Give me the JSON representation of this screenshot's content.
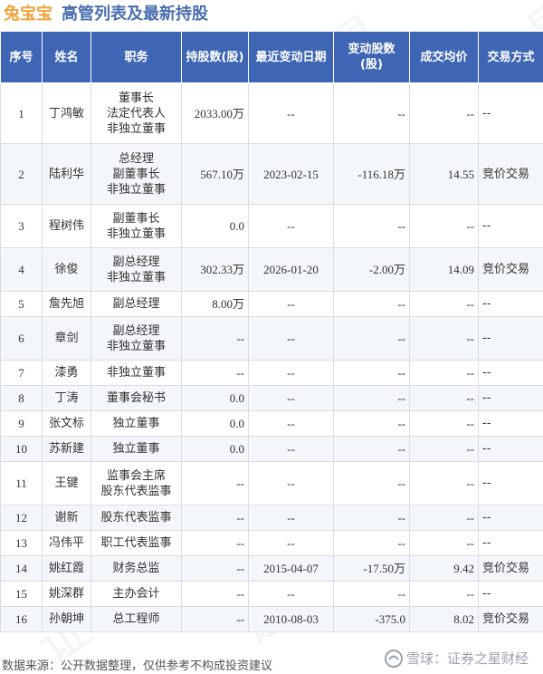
{
  "header": {
    "company": "兔宝宝",
    "title": "高管列表及最新持股"
  },
  "watermark_text": "证券之星",
  "table": {
    "columns": [
      "序号",
      "姓名",
      "职务",
      "持股数(股)",
      "最近变动日期",
      "变动股数(股)",
      "成交均价",
      "交易方式"
    ],
    "rows": [
      {
        "idx": "1",
        "name": "丁鸿敏",
        "positions": [
          "董事长",
          "法定代表人",
          "非独立董事"
        ],
        "holding": "2033.00万",
        "date": "--",
        "change": "--",
        "price": "--",
        "mode": "--"
      },
      {
        "idx": "2",
        "name": "陆利华",
        "positions": [
          "总经理",
          "副董事长",
          "非独立董事"
        ],
        "holding": "567.10万",
        "date": "2023-02-15",
        "change": "-116.18万",
        "price": "14.55",
        "mode": "竞价交易"
      },
      {
        "idx": "3",
        "name": "程树伟",
        "positions": [
          "副董事长",
          "非独立董事"
        ],
        "holding": "0.0",
        "date": "--",
        "change": "--",
        "price": "--",
        "mode": "--"
      },
      {
        "idx": "4",
        "name": "徐俊",
        "positions": [
          "副总经理",
          "非独立董事"
        ],
        "holding": "302.33万",
        "date": "2026-01-20",
        "change": "-2.00万",
        "price": "14.09",
        "mode": "竞价交易"
      },
      {
        "idx": "5",
        "name": "詹先旭",
        "positions": [
          "副总经理"
        ],
        "holding": "8.00万",
        "date": "--",
        "change": "--",
        "price": "--",
        "mode": "--"
      },
      {
        "idx": "6",
        "name": "章剑",
        "positions": [
          "副总经理",
          "非独立董事"
        ],
        "holding": "--",
        "date": "--",
        "change": "--",
        "price": "--",
        "mode": "--"
      },
      {
        "idx": "7",
        "name": "漆勇",
        "positions": [
          "非独立董事"
        ],
        "holding": "--",
        "date": "--",
        "change": "--",
        "price": "--",
        "mode": "--"
      },
      {
        "idx": "8",
        "name": "丁涛",
        "positions": [
          "董事会秘书"
        ],
        "holding": "0.0",
        "date": "--",
        "change": "--",
        "price": "--",
        "mode": "--"
      },
      {
        "idx": "9",
        "name": "张文标",
        "positions": [
          "独立董事"
        ],
        "holding": "0.0",
        "date": "--",
        "change": "--",
        "price": "--",
        "mode": "--"
      },
      {
        "idx": "10",
        "name": "苏新建",
        "positions": [
          "独立董事"
        ],
        "holding": "0.0",
        "date": "--",
        "change": "--",
        "price": "--",
        "mode": "--"
      },
      {
        "idx": "11",
        "name": "王键",
        "positions": [
          "监事会主席",
          "股东代表监事"
        ],
        "holding": "--",
        "date": "--",
        "change": "--",
        "price": "--",
        "mode": "--"
      },
      {
        "idx": "12",
        "name": "谢新",
        "positions": [
          "股东代表监事"
        ],
        "holding": "--",
        "date": "--",
        "change": "--",
        "price": "--",
        "mode": "--"
      },
      {
        "idx": "13",
        "name": "冯伟平",
        "positions": [
          "职工代表监事"
        ],
        "holding": "--",
        "date": "--",
        "change": "--",
        "price": "--",
        "mode": "--"
      },
      {
        "idx": "14",
        "name": "姚红霞",
        "positions": [
          "财务总监"
        ],
        "holding": "--",
        "date": "2015-04-07",
        "change": "-17.50万",
        "price": "9.42",
        "mode": "竞价交易"
      },
      {
        "idx": "15",
        "name": "姚深群",
        "positions": [
          "主办会计"
        ],
        "holding": "--",
        "date": "--",
        "change": "--",
        "price": "--",
        "mode": "--"
      },
      {
        "idx": "16",
        "name": "孙朝坤",
        "positions": [
          "总工程师"
        ],
        "holding": "--",
        "date": "2010-08-03",
        "change": "-375.0",
        "price": "8.02",
        "mode": "竞价交易"
      }
    ]
  },
  "footer": {
    "source": "数据来源：公开数据整理，仅供参考不构成投资建议",
    "brand": "雪球：证券之星财经"
  },
  "colors": {
    "header_bg": "#3f66b5",
    "company": "#f0a33a",
    "title": "#4a6fb0",
    "green": "#1d9a3a"
  }
}
